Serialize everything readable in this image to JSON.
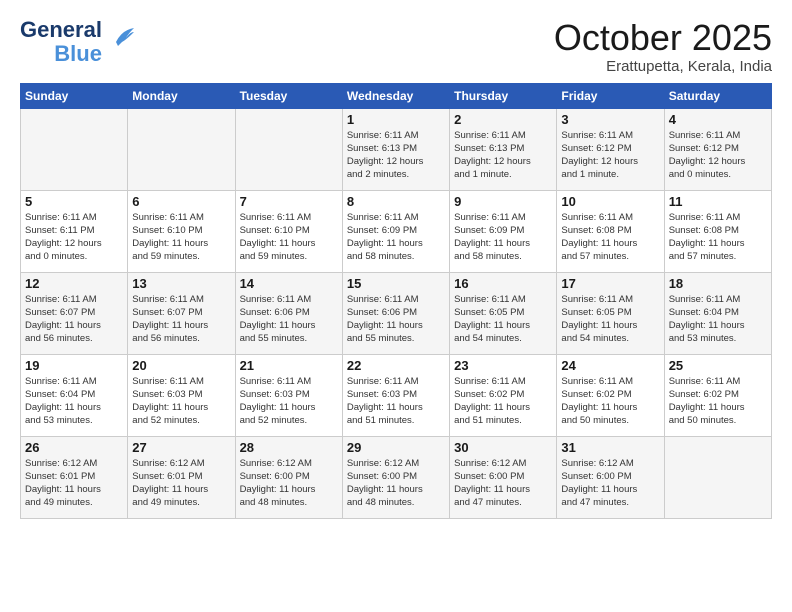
{
  "header": {
    "logo_line1": "General",
    "logo_line2": "Blue",
    "month": "October 2025",
    "location": "Erattupetta, Kerala, India"
  },
  "weekdays": [
    "Sunday",
    "Monday",
    "Tuesday",
    "Wednesday",
    "Thursday",
    "Friday",
    "Saturday"
  ],
  "weeks": [
    [
      {
        "day": "",
        "info": ""
      },
      {
        "day": "",
        "info": ""
      },
      {
        "day": "",
        "info": ""
      },
      {
        "day": "1",
        "info": "Sunrise: 6:11 AM\nSunset: 6:13 PM\nDaylight: 12 hours\nand 2 minutes."
      },
      {
        "day": "2",
        "info": "Sunrise: 6:11 AM\nSunset: 6:13 PM\nDaylight: 12 hours\nand 1 minute."
      },
      {
        "day": "3",
        "info": "Sunrise: 6:11 AM\nSunset: 6:12 PM\nDaylight: 12 hours\nand 1 minute."
      },
      {
        "day": "4",
        "info": "Sunrise: 6:11 AM\nSunset: 6:12 PM\nDaylight: 12 hours\nand 0 minutes."
      }
    ],
    [
      {
        "day": "5",
        "info": "Sunrise: 6:11 AM\nSunset: 6:11 PM\nDaylight: 12 hours\nand 0 minutes."
      },
      {
        "day": "6",
        "info": "Sunrise: 6:11 AM\nSunset: 6:10 PM\nDaylight: 11 hours\nand 59 minutes."
      },
      {
        "day": "7",
        "info": "Sunrise: 6:11 AM\nSunset: 6:10 PM\nDaylight: 11 hours\nand 59 minutes."
      },
      {
        "day": "8",
        "info": "Sunrise: 6:11 AM\nSunset: 6:09 PM\nDaylight: 11 hours\nand 58 minutes."
      },
      {
        "day": "9",
        "info": "Sunrise: 6:11 AM\nSunset: 6:09 PM\nDaylight: 11 hours\nand 58 minutes."
      },
      {
        "day": "10",
        "info": "Sunrise: 6:11 AM\nSunset: 6:08 PM\nDaylight: 11 hours\nand 57 minutes."
      },
      {
        "day": "11",
        "info": "Sunrise: 6:11 AM\nSunset: 6:08 PM\nDaylight: 11 hours\nand 57 minutes."
      }
    ],
    [
      {
        "day": "12",
        "info": "Sunrise: 6:11 AM\nSunset: 6:07 PM\nDaylight: 11 hours\nand 56 minutes."
      },
      {
        "day": "13",
        "info": "Sunrise: 6:11 AM\nSunset: 6:07 PM\nDaylight: 11 hours\nand 56 minutes."
      },
      {
        "day": "14",
        "info": "Sunrise: 6:11 AM\nSunset: 6:06 PM\nDaylight: 11 hours\nand 55 minutes."
      },
      {
        "day": "15",
        "info": "Sunrise: 6:11 AM\nSunset: 6:06 PM\nDaylight: 11 hours\nand 55 minutes."
      },
      {
        "day": "16",
        "info": "Sunrise: 6:11 AM\nSunset: 6:05 PM\nDaylight: 11 hours\nand 54 minutes."
      },
      {
        "day": "17",
        "info": "Sunrise: 6:11 AM\nSunset: 6:05 PM\nDaylight: 11 hours\nand 54 minutes."
      },
      {
        "day": "18",
        "info": "Sunrise: 6:11 AM\nSunset: 6:04 PM\nDaylight: 11 hours\nand 53 minutes."
      }
    ],
    [
      {
        "day": "19",
        "info": "Sunrise: 6:11 AM\nSunset: 6:04 PM\nDaylight: 11 hours\nand 53 minutes."
      },
      {
        "day": "20",
        "info": "Sunrise: 6:11 AM\nSunset: 6:03 PM\nDaylight: 11 hours\nand 52 minutes."
      },
      {
        "day": "21",
        "info": "Sunrise: 6:11 AM\nSunset: 6:03 PM\nDaylight: 11 hours\nand 52 minutes."
      },
      {
        "day": "22",
        "info": "Sunrise: 6:11 AM\nSunset: 6:03 PM\nDaylight: 11 hours\nand 51 minutes."
      },
      {
        "day": "23",
        "info": "Sunrise: 6:11 AM\nSunset: 6:02 PM\nDaylight: 11 hours\nand 51 minutes."
      },
      {
        "day": "24",
        "info": "Sunrise: 6:11 AM\nSunset: 6:02 PM\nDaylight: 11 hours\nand 50 minutes."
      },
      {
        "day": "25",
        "info": "Sunrise: 6:11 AM\nSunset: 6:02 PM\nDaylight: 11 hours\nand 50 minutes."
      }
    ],
    [
      {
        "day": "26",
        "info": "Sunrise: 6:12 AM\nSunset: 6:01 PM\nDaylight: 11 hours\nand 49 minutes."
      },
      {
        "day": "27",
        "info": "Sunrise: 6:12 AM\nSunset: 6:01 PM\nDaylight: 11 hours\nand 49 minutes."
      },
      {
        "day": "28",
        "info": "Sunrise: 6:12 AM\nSunset: 6:00 PM\nDaylight: 11 hours\nand 48 minutes."
      },
      {
        "day": "29",
        "info": "Sunrise: 6:12 AM\nSunset: 6:00 PM\nDaylight: 11 hours\nand 48 minutes."
      },
      {
        "day": "30",
        "info": "Sunrise: 6:12 AM\nSunset: 6:00 PM\nDaylight: 11 hours\nand 47 minutes."
      },
      {
        "day": "31",
        "info": "Sunrise: 6:12 AM\nSunset: 6:00 PM\nDaylight: 11 hours\nand 47 minutes."
      },
      {
        "day": "",
        "info": ""
      }
    ]
  ]
}
